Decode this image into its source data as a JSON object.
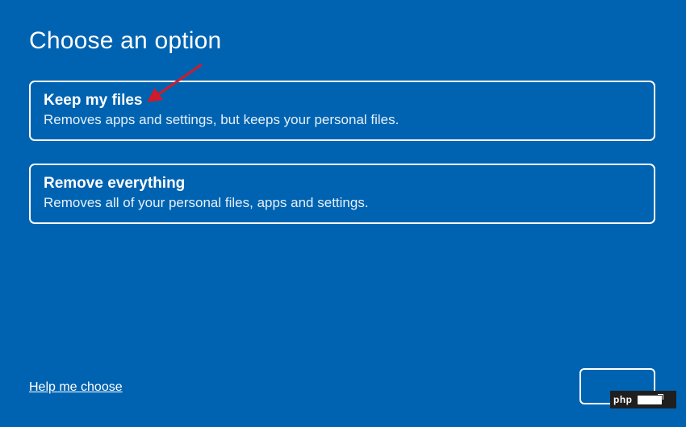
{
  "page": {
    "title": "Choose an option"
  },
  "options": [
    {
      "title": "Keep my files",
      "description": "Removes apps and settings, but keeps your personal files."
    },
    {
      "title": "Remove everything",
      "description": "Removes all of your personal files, apps and settings."
    }
  ],
  "help_link": "Help me choose",
  "bottom_button_label": "",
  "watermark": {
    "text": "php"
  },
  "annotation": {
    "arrow_color": "#d11a2a"
  }
}
